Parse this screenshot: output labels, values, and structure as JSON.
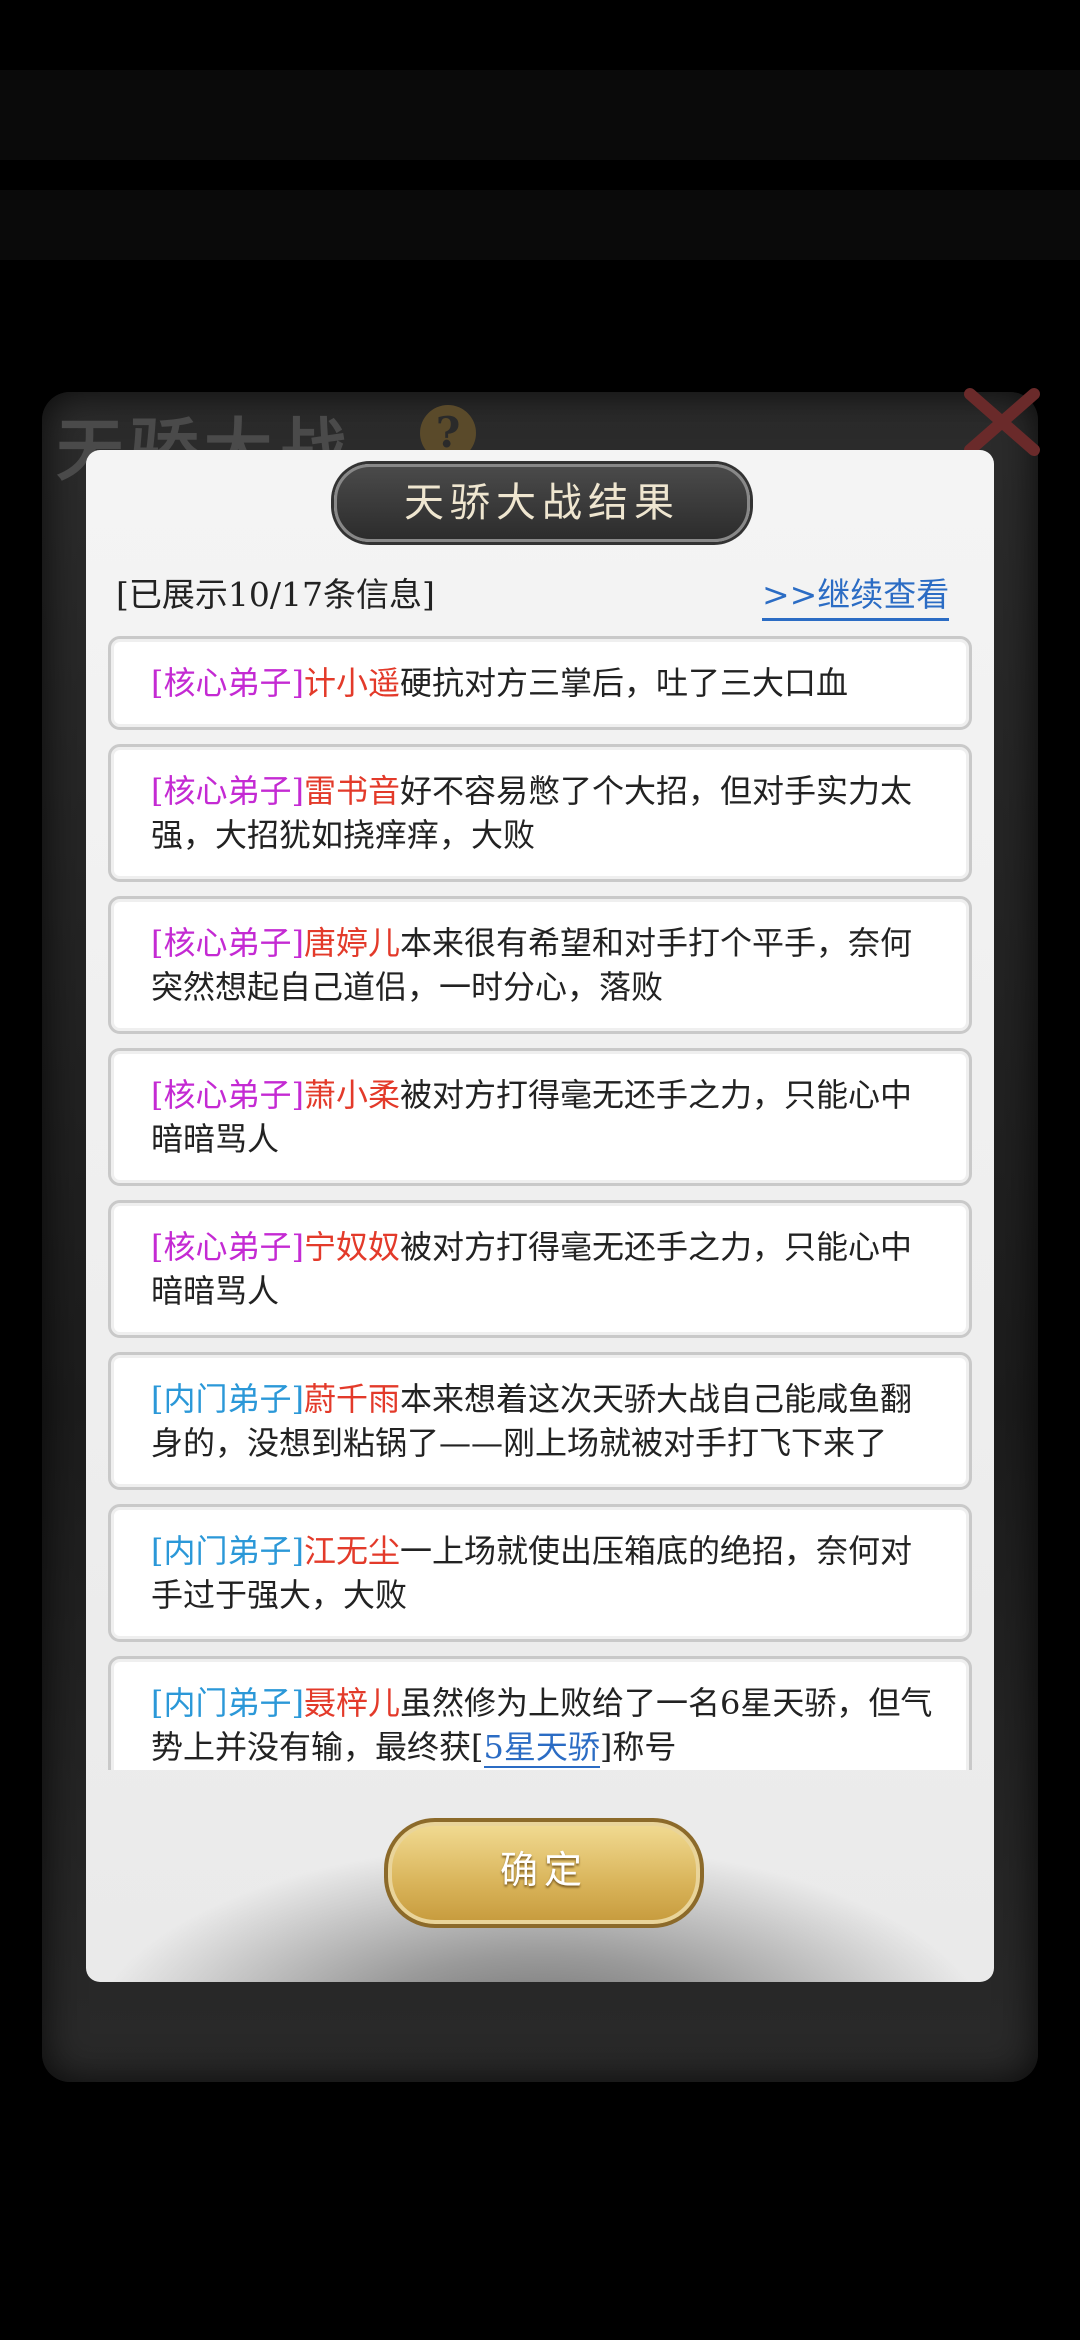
{
  "background": {
    "title": "天骄大战",
    "help_icon": "?"
  },
  "modal": {
    "title": "天骄大战结果",
    "info_count": "[已展示10/17条信息]",
    "continue_link": ">>继续查看",
    "confirm_label": "确定"
  },
  "results": [
    {
      "tag_open": "[",
      "tag": "核心弟子",
      "tag_close": "]",
      "name": "计小遥",
      "text": "硬抗对方三掌后，吐了三大口血",
      "type": "core"
    },
    {
      "tag_open": "[",
      "tag": "核心弟子",
      "tag_close": "]",
      "name": "雷书音",
      "text": "好不容易憋了个大招，但对手实力太强，大招犹如挠痒痒，大败",
      "type": "core"
    },
    {
      "tag_open": "[",
      "tag": "核心弟子",
      "tag_close": "]",
      "name": "唐婷儿",
      "text": "本来很有希望和对手打个平手，奈何突然想起自己道侣，一时分心，落败",
      "type": "core"
    },
    {
      "tag_open": "[",
      "tag": "核心弟子",
      "tag_close": "]",
      "name": "萧小柔",
      "text": "被对方打得毫无还手之力，只能心中暗暗骂人",
      "type": "core"
    },
    {
      "tag_open": "[",
      "tag": "核心弟子",
      "tag_close": "]",
      "name": "宁奴奴",
      "text": "被对方打得毫无还手之力，只能心中暗暗骂人",
      "type": "core"
    },
    {
      "tag_open": "[",
      "tag": "内门弟子",
      "tag_close": "]",
      "name": "蔚千雨",
      "text": "本来想着这次天骄大战自己能咸鱼翻身的，没想到粘锅了——刚上场就被对手打飞下来了",
      "type": "inner"
    },
    {
      "tag_open": "[",
      "tag": "内门弟子",
      "tag_close": "]",
      "name": "江无尘",
      "text": "一上场就使出压箱底的绝招，奈何对手过于强大，大败",
      "type": "inner"
    },
    {
      "tag_open": "[",
      "tag": "内门弟子",
      "tag_close": "]",
      "name": "聂梓儿",
      "text": "虽然修为上败给了一名6星天骄，但气势上并没有输，最终获",
      "link": "5星天骄",
      "after": "称号",
      "type": "inner"
    }
  ],
  "colors": {
    "core_tag": "#c42ad3",
    "inner_tag": "#2b98d8",
    "name": "#e33a2a",
    "link": "#2b6cc4"
  }
}
